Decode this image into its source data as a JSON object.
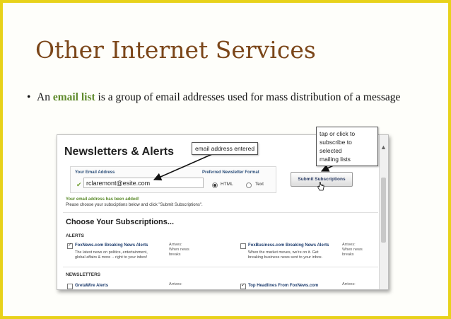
{
  "slide": {
    "title": "Other Internet Services",
    "bullet": {
      "prefix": "An",
      "term": "email list",
      "text": "is a group of email addresses used for mass distribution of a message"
    }
  },
  "screenshot": {
    "heading": "Newsletters & Alerts",
    "form": {
      "email_label": "Your Email Address",
      "email_value": "rclaremont@esite.com",
      "format_label": "Preferred Newsletter Format",
      "format_options": [
        "HTML",
        "Text"
      ],
      "format_selected": "HTML"
    },
    "submit_label": "Submit Subscriptions",
    "confirm_message": "Your email address has been added!",
    "confirm_sub": "Please choose your subsciptions below and click \"Submit Subscriptions\".",
    "choose_title": "Choose Your Subscriptions...",
    "alerts_label": "ALERTS",
    "newsletters_label": "NEWSLETTERS",
    "alerts": [
      {
        "name": "FoxNews.com Breaking News Alerts",
        "checked": true,
        "desc_1": "The latest news on politics, entertainment,",
        "desc_2": "global affairs & more -- right to your inbox!",
        "arrives_1": "Arrives:",
        "arrives_2": "When news",
        "arrives_3": "breaks"
      },
      {
        "name": "FoxBusiness.com Breaking News Alerts",
        "checked": false,
        "desc_1": "When the market moves, we're on it. Get",
        "desc_2": "breaking business news sent to your inbox.",
        "arrives_1": "Arrives:",
        "arrives_2": "When news",
        "arrives_3": "breaks"
      }
    ],
    "newsletters": [
      {
        "name": "GretaWire Alerts",
        "checked": false,
        "arrives": "Arrives:"
      },
      {
        "name": "Top Headlines From FoxNews.com",
        "checked": true,
        "arrives": "Arrives:"
      }
    ]
  },
  "callouts": {
    "email": "email address entered",
    "tap_1": "tap or click to",
    "tap_2": "subscribe to selected",
    "tap_3": "mailing lists"
  }
}
